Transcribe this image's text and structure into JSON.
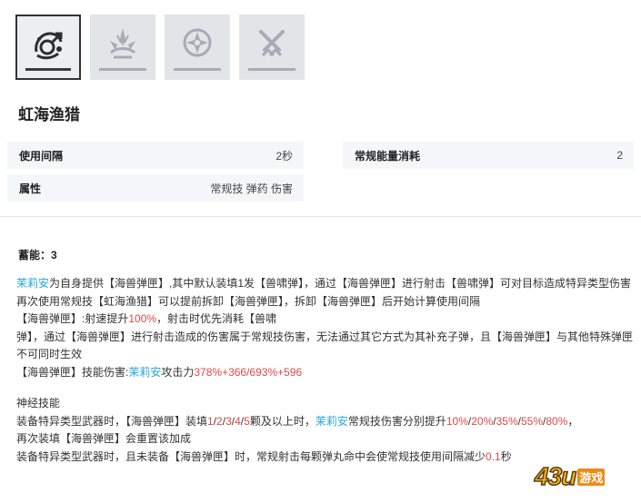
{
  "tabs": [
    {
      "icon": "rainbow-sea-hunt-skill-icon",
      "active": true
    },
    {
      "icon": "burst-skill-icon",
      "active": false
    },
    {
      "icon": "star-burst-skill-icon",
      "active": false
    },
    {
      "icon": "crossed-blades-skill-icon",
      "active": false
    }
  ],
  "skill": {
    "title": "虹海渔猎"
  },
  "stats": {
    "interval": {
      "label": "使用间隔",
      "value": "2秒"
    },
    "energy": {
      "label": "常规能量消耗",
      "value": "2"
    },
    "attribute": {
      "label": "属性",
      "value": "常规技 弹药 伤害"
    }
  },
  "charge": {
    "label": "蓄能：",
    "value": "3"
  },
  "desc": {
    "p1_name": "茉莉安",
    "p1_text": "为自身提供【海兽弹匣】,其中默认装填1发【兽啸弹】，通过【海兽弹匣】进行射击【兽啸弹】可对目标造成特异类型伤害",
    "p2": "再次使用常规技【虹海渔猎】可以提前拆卸【海兽弹匣】，拆卸【海兽弹匣】后开始计算使用间隔",
    "p3a": "【海兽弹匣】:射速提升",
    "p3_num": "100%",
    "p3b": "，射击时优先消耗【兽啸",
    "p4": "弹】，通过【海兽弹匣】进行射击造成的伤害属于常规技伤害，无法通过其它方式为其补充子弹，且【海兽弹匣】与其他特殊弹匣不可同时生效",
    "p5a": "【海兽弹匣】技能伤害:",
    "p5_name": "茉莉安",
    "p5b": "攻击力",
    "p5_num": "378%+366/693%+596",
    "neural_title": "神经技能",
    "n1a": "装备特异类型武器时，【海兽弹匣】装填",
    "n1_counts": [
      "1",
      "2",
      "3",
      "4",
      "5"
    ],
    "n1b": "颗及以上时，",
    "n1_name": "茉莉安",
    "n1c": "常规技伤害分别提升",
    "n1_vals": [
      "10%",
      "20%",
      "35%",
      "55%",
      "80%"
    ],
    "n1_end": "，",
    "n2": "再次装填【海兽弹匣】会重置该加成",
    "n3a": "装备特异类型武器时，且未装备【海兽弹匣】时，常规射击每颗弹丸命中会使常规技使用间隔减少",
    "n3_num": "0.1",
    "n3b": "秒"
  },
  "watermark": {
    "num": "43u",
    "text": "游戏"
  }
}
